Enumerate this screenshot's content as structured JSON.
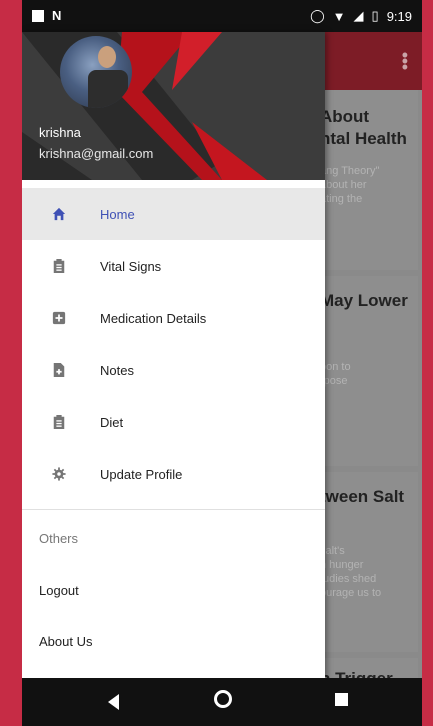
{
  "status_bar": {
    "time": "9:19"
  },
  "drawer": {
    "user_name": "krishna",
    "user_email": "krishna@gmail.com",
    "items": [
      {
        "label": "Home",
        "icon": "home-icon",
        "active": true
      },
      {
        "label": "Vital Signs",
        "icon": "clipboard-icon"
      },
      {
        "label": "Medication Details",
        "icon": "plus-box-icon"
      },
      {
        "label": "Notes",
        "icon": "note-add-icon"
      },
      {
        "label": "Diet",
        "icon": "clipboard-icon"
      },
      {
        "label": "Update Profile",
        "icon": "gear-icon"
      }
    ],
    "section_label": "Others",
    "logout_label": "Logout",
    "about_label": "About Us"
  },
  "feed": {
    "cards": [
      {
        "title_lines": [
          "About",
          "ntal Health"
        ],
        "text_lines": [
          "ang Theory\"",
          "about her",
          "ating the"
        ]
      },
      {
        "title_lines": [
          "May Lower",
          ":"
        ],
        "text_lines": [
          "oon to",
          "rpose"
        ]
      },
      {
        "title_lines": [
          "tween Salt"
        ],
        "text_lines": [
          "salt's",
          "n hunger",
          "tudies shed",
          "ourage us to"
        ]
      },
      {
        "title_lines": [
          "n Trigger"
        ],
        "text_lines": []
      }
    ]
  },
  "colors": {
    "accent": "#3f51b5",
    "appbar": "#7d1c26",
    "background": "#c62c45"
  }
}
